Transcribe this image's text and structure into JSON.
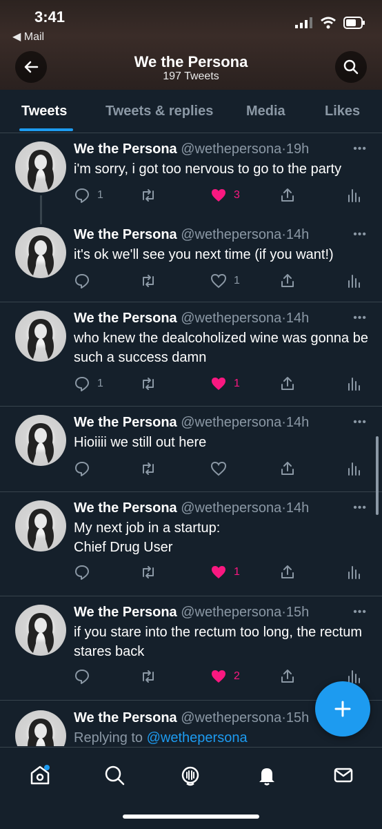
{
  "status_bar": {
    "time": "3:41",
    "back_app": "◀ Mail"
  },
  "header": {
    "title": "We the Persona",
    "subtitle": "197 Tweets"
  },
  "tabs": [
    {
      "label": "Tweets",
      "active": true
    },
    {
      "label": "Tweets & replies"
    },
    {
      "label": "Media"
    },
    {
      "label": "Likes"
    }
  ],
  "tweets": [
    {
      "name": "We the Persona",
      "handle": "@wethepersona",
      "time": "19h",
      "text": "i'm sorry, i got too nervous to go to the party",
      "replies": "1",
      "likes": "3",
      "liked": true
    },
    {
      "name": "We the Persona",
      "handle": "@wethepersona",
      "time": "14h",
      "text": "it's ok we'll see you next time (if you want!)",
      "replies": "",
      "likes": "1",
      "liked": false
    },
    {
      "name": "We the Persona",
      "handle": "@wethepersona",
      "time": "14h",
      "text": "who knew the dealcoholized wine was gonna be such a success damn",
      "replies": "1",
      "likes": "1",
      "liked": true
    },
    {
      "name": "We the Persona",
      "handle": "@wethepersona",
      "time": "14h",
      "text": "Hioiiii we still out here",
      "replies": "",
      "likes": "",
      "liked": false
    },
    {
      "name": "We the Persona",
      "handle": "@wethepersona",
      "time": "14h",
      "text": "My next job in a startup:\nChief Drug User",
      "replies": "",
      "likes": "1",
      "liked": true
    },
    {
      "name": "We the Persona",
      "handle": "@wethepersona",
      "time": "15h",
      "text": "if you stare into the rectum too long, the rectum stares back",
      "replies": "",
      "likes": "2",
      "liked": true
    },
    {
      "name": "We the Persona",
      "handle": "@wethepersona",
      "time": "15h",
      "reply_prefix": "Replying to",
      "reply_mention": "@wethepersona"
    }
  ],
  "more_label": "•••",
  "icons": {
    "back": "arrow-left-icon",
    "search": "search-icon",
    "compose": "plus-icon",
    "nav": [
      "home-icon",
      "explore-icon",
      "spaces-icon",
      "notifications-icon",
      "messages-icon"
    ]
  },
  "colors": {
    "background": "#15202b",
    "accent": "#1d9bf0",
    "like": "#f91880",
    "muted": "#8b98a5"
  }
}
